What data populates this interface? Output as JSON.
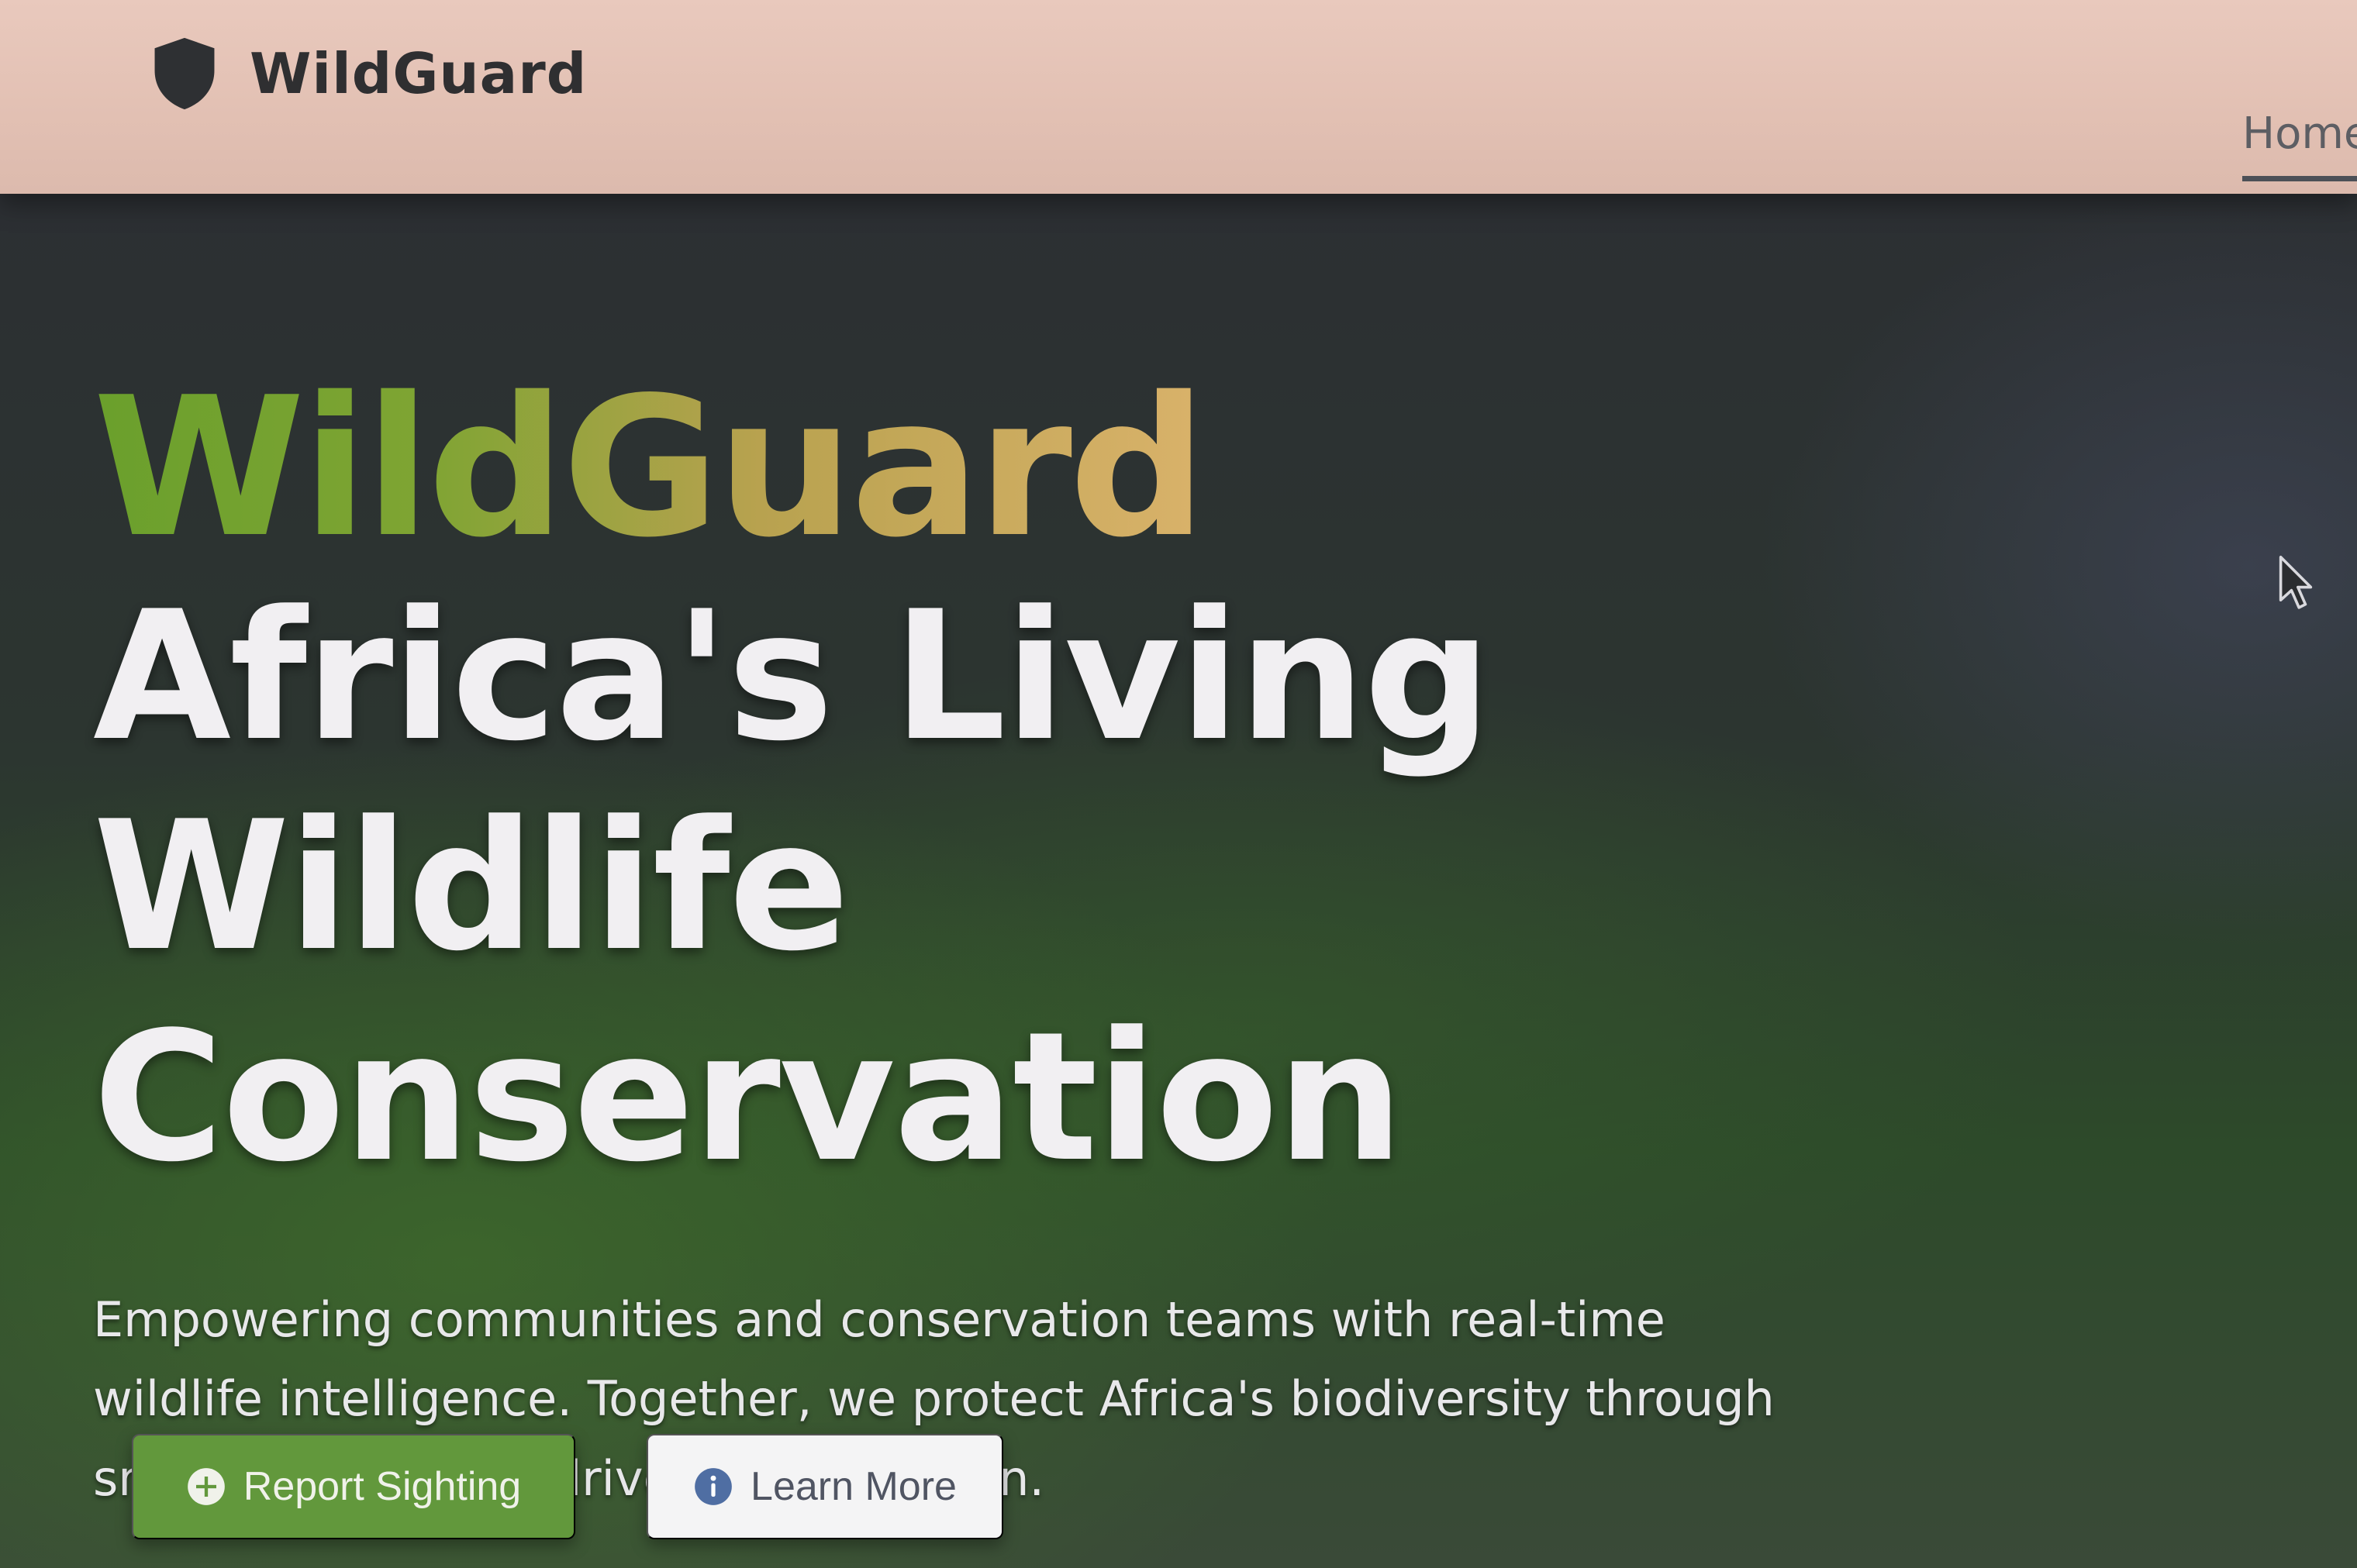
{
  "header": {
    "brand_name": "WildGuard",
    "logo_icon": "shield-icon",
    "nav": [
      {
        "label": "Home",
        "active": true
      }
    ]
  },
  "hero": {
    "brand_headline": "WildGuard",
    "headline_line1": "Africa's Living Wildlife",
    "headline_line2": "Conservation",
    "subtitle": "Empowering communities and conservation teams with real-time wildlife intelligence. Together, we protect Africa's biodiversity through smart, community-driven conservation.",
    "buttons": {
      "primary": {
        "label": "Report Sighting",
        "icon": "plus-circle-icon"
      },
      "secondary": {
        "label": "Learn More",
        "icon": "info-circle-icon"
      }
    }
  },
  "colors": {
    "header_bg": "#e2c0b3",
    "brand_gradient_start": "#6aa02c",
    "brand_gradient_end": "#d9b26a",
    "primary_button": "#62983c",
    "secondary_button": "#f4f4f5",
    "headline_text": "#f1eff2"
  }
}
